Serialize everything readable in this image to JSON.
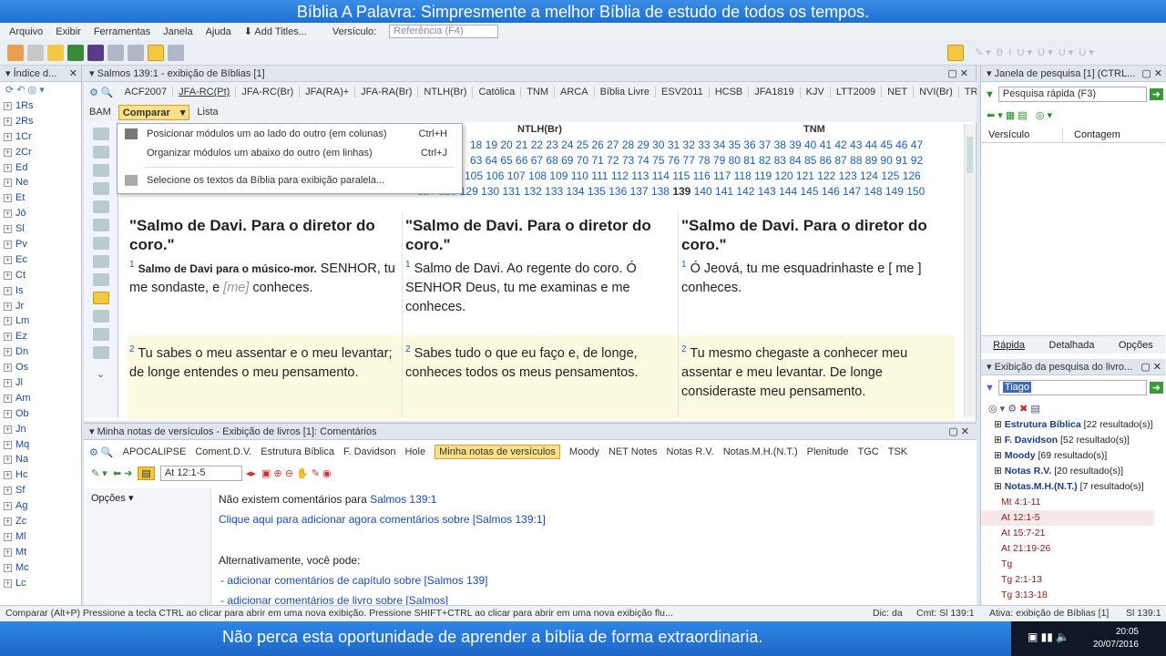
{
  "banner_top": "Bíblia A Palavra: Simpresmente a melhor Bíblia de estudo de todos os tempos.",
  "menu": [
    "Arquivo",
    "Exibir",
    "Ferramentas",
    "Janela",
    "Ajuda"
  ],
  "add_titles": "Add Titles...",
  "versiculo_label": "Versículo:",
  "versiculo_placeholder": "Referência (F4)",
  "left_panel": {
    "title": "Índice d...",
    "books": [
      "1Rs",
      "2Rs",
      "1Cr",
      "2Cr",
      "Ed",
      "Ne",
      "Et",
      "Jó",
      "Sl",
      "Pv",
      "Ec",
      "Ct",
      "Is",
      "Jr",
      "Lm",
      "Ez",
      "Dn",
      "Os",
      "Jl",
      "Am",
      "Ob",
      "Jn",
      "Mq",
      "Na",
      "Hc",
      "Sf",
      "Ag",
      "Zc",
      "Ml",
      "Mt",
      "Mc",
      "Lc"
    ]
  },
  "bible_panel": {
    "title": "Salmos 139:1 - exibição de Bíblias [1]",
    "modules": [
      "ACF2007",
      "JFA-RC(Pt)",
      "JFA-RC(Br)",
      "JFA(RA)+",
      "JFA-RA(Br)",
      "NTLH(Br)",
      "Católica",
      "TNM",
      "ARCA",
      "Bíblia Livre",
      "ESV2011",
      "HCSB",
      "JFA1819",
      "KJV",
      "LTT2009",
      "NET",
      "NVI(Br)",
      "TR",
      "VIVA(Br)",
      "WLC"
    ],
    "bam": "BAM",
    "compare": "Comparar",
    "lista": "Lista",
    "col_heads": [
      "NTLH(Br)",
      "TNM"
    ],
    "num_row1": "18 19 20 21 22 23 24 25 26 27 28 29 30 31 32 33 34 35 36 37 38 39 40 41 42 43 44 45 46 47",
    "num_row2": "63 64 65 66 67 68 69 70 71 72 73 74 75 76 77 78 79 80 81 82 83 84 85 86 87 88 89 90 91 92",
    "num_row3": "105 106 107 108 109 110 111 112 113 114 115 116 117 118 119 120 121 122 123 124 125 126",
    "num_row4a": "129 130 131 132 133 134 135 136 137 138",
    "num_current": "139",
    "num_row4b": "140 141 142 143 144 145 146 147 148 149 150",
    "num_partial": "127 128",
    "columns": [
      {
        "title": "\"Salmo de Davi. Para o diretor do coro.\"",
        "v1_bold": "Salmo de Davi para o músico-mor.",
        "v1": " SENHOR, tu me sondaste, e ",
        "v1_bracket": "[me]",
        "v1_end": " conheces.",
        "v2": "Tu sabes o meu assentar e o meu levantar; de longe entendes o meu pensamento."
      },
      {
        "title": "\"Salmo de Davi. Para o diretor do coro.\"",
        "v1": "Salmo de Davi. Ao regente do coro. Ó SENHOR Deus, tu me examinas e me conheces.",
        "v2": "Sabes tudo o que eu faço e, de longe, conheces todos os meus pensamentos."
      },
      {
        "title": "\"Salmo de Davi. Para o diretor do coro.\"",
        "v1": "Ó Jeová, tu me esquadrinhaste e [ me ] conheces.",
        "v2": "Tu mesmo chegaste a conhecer meu assentar e meu levantar. De longe consideraste meu pensamento."
      }
    ],
    "verse_nums": [
      "1",
      "2"
    ]
  },
  "dropdown": [
    {
      "label": "Posicionar módulos um ao lado do outro (em colunas)",
      "shortcut": "Ctrl+H"
    },
    {
      "label": "Organizar módulos um abaixo do outro (em linhas)",
      "shortcut": "Ctrl+J"
    },
    {
      "label": "Selecione os textos da Bíblia para exibição paralela...",
      "shortcut": ""
    }
  ],
  "right_panel": {
    "title": "Janela de pesquisa [1] (CTRL...",
    "quick_search_placeholder": "Pesquisa rápida (F3)",
    "col_versiculo": "Versículo",
    "col_contagem": "Contagem",
    "tabs": [
      "Rápida",
      "Detalhada",
      "Opções"
    ],
    "results_title": "Exibição da pesquisa do livro...",
    "search_value": "Tiago",
    "results": [
      {
        "name": "Estrutura Bíblica",
        "count": "[22 resultado(s)]"
      },
      {
        "name": "F. Davidson",
        "count": "[52 resultado(s)]"
      },
      {
        "name": "Moody",
        "count": "[69 resultado(s)]"
      },
      {
        "name": "Notas R.V.",
        "count": "[20 resultado(s)]"
      },
      {
        "name": "Notas.M.H.(N.T.)",
        "count": "[7 resultado(s)]"
      }
    ],
    "refs": [
      "Mt 4:1-11",
      "At 12:1-5",
      "At 15:7-21",
      "At 21:19-26",
      "Tg",
      "Tg 2:1-13",
      "Tg 3:13-18"
    ]
  },
  "bottom_panel": {
    "title": "Minha notas de versículos - Exibição de livros [1]: Comentários",
    "tabs": [
      "APOCALIPSE",
      "Coment.D.V.",
      "Estrutura Bíblica",
      "F. Davidson",
      "Hole",
      "Minha notas de versículos",
      "Moody",
      "NET Notes",
      "Notas R.V.",
      "Notas.M.H.(N.T.)",
      "Plenitude",
      "TGC",
      "TSK"
    ],
    "ref_value": "At 12:1-5",
    "opcoes": "Opções",
    "no_comments_prefix": "Não existem comentários para ",
    "no_comments_ref": "Salmos 139:1",
    "add_now": "Clique aqui para adicionar agora comentários sobre [Salmos 139:1]",
    "alt": "Alternativamente, você pode:",
    "add_chapter": "- adicionar comentários de capítulo sobre [Salmos 139]",
    "add_book": "- adicionar comentários de livro sobre [Salmos]"
  },
  "status": {
    "left": "Comparar (Alt+P)  Pressione a tecla CTRL ao clicar para abrir em uma nova exibição. Pressione SHIFT+CTRL ao clicar para abrir em uma nova exibição flu...",
    "dic": "Dic: da",
    "cmt": "Cmt: Sl 139:1",
    "ativa": "Ativa: exibição de Bíblias [1]",
    "ref": "Sl 139:1"
  },
  "banner_bottom": "Não perca esta oportunidade de aprender a bíblia de forma extraordinaria.",
  "tray": {
    "time": "20:05",
    "date": "20/07/2016"
  }
}
